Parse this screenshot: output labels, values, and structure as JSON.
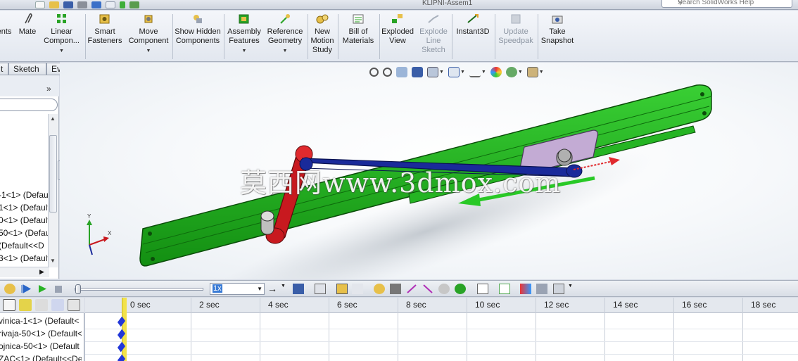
{
  "titlebar": {
    "doc_title": "KLIPNI-Assem1",
    "search_placeholder": "Search SolidWorks Help"
  },
  "ribbon": {
    "buttons": [
      {
        "id": "ments",
        "label": "ents"
      },
      {
        "id": "mate",
        "label": "Mate"
      },
      {
        "id": "linear",
        "label": "Linear Compon..."
      },
      {
        "id": "smart",
        "label": "Smart Fasteners"
      },
      {
        "id": "move",
        "label": "Move Component"
      },
      {
        "id": "showhidden",
        "label": "Show Hidden Components"
      },
      {
        "id": "asmfeat",
        "label": "Assembly Features"
      },
      {
        "id": "refgeo",
        "label": "Reference Geometry"
      },
      {
        "id": "newmotion",
        "label": "New Motion Study"
      },
      {
        "id": "bom",
        "label": "Bill of Materials"
      },
      {
        "id": "exploded",
        "label": "Exploded View"
      },
      {
        "id": "explodeline",
        "label": "Explode Line Sketch"
      },
      {
        "id": "instant3d",
        "label": "Instant3D"
      },
      {
        "id": "speedpak",
        "label": "Update Speedpak"
      },
      {
        "id": "snapshot",
        "label": "Take Snapshot"
      }
    ]
  },
  "tabs": {
    "t0": "t",
    "sketch": "Sketch",
    "evaluate": "Evaluate"
  },
  "tree": {
    "items": [
      "-1<1> (Defau",
      "1<1> (Default",
      "0<1> (Default",
      "50<1> (Defau",
      " (Default<<D",
      "3<1> (Default"
    ]
  },
  "timeline": {
    "speed": "1x",
    "ticks": [
      "0 sec",
      "2 sec",
      "4 sec",
      "6 sec",
      "8 sec",
      "10 sec",
      "12 sec",
      "14 sec",
      "16 sec",
      "18 sec"
    ],
    "rows": [
      "vinica-1<1> (Default<",
      "rivaja-50<1> (Default<",
      "ojnica-50<1> (Default",
      "ZAC<1> (Default<<De"
    ]
  },
  "viewport": {
    "watermark": "莫西网www.3dmox.com",
    "triad": {
      "x_label": "X",
      "y_label": "Y"
    }
  },
  "colors": {
    "base": "#1db31a",
    "link_red": "#c8191f",
    "link_blue": "#1a2a9a",
    "slider_purple": "#b9a0cc"
  }
}
